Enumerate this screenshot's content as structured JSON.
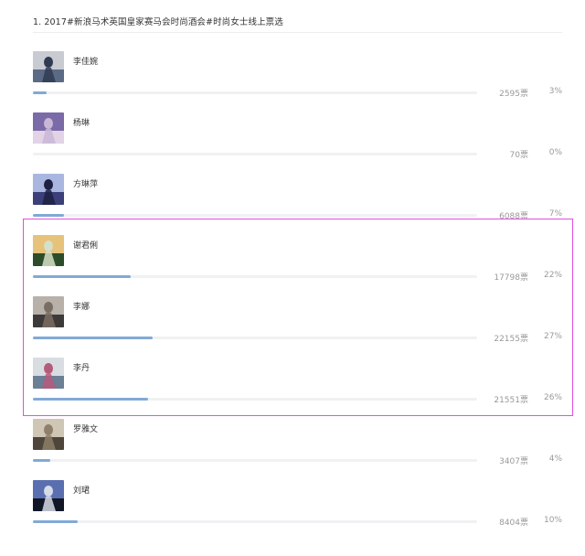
{
  "poll": {
    "title": "1. 2017#新浪马术英国皇家赛马会时尚酒会#时尚女士线上票选",
    "accent_color": "#82a9d6",
    "highlight_color": "#e04fe0",
    "candidates": [
      {
        "name": "李佳婉",
        "votes": "2595票",
        "percent": "3%",
        "share": 0.03,
        "thumbnail": "photo-thumbnail"
      },
      {
        "name": "杨琳",
        "votes": "70票",
        "percent": "0%",
        "share": 0.0,
        "thumbnail": "photo-thumbnail"
      },
      {
        "name": "方琳萍",
        "votes": "6088票",
        "percent": "7%",
        "share": 0.07,
        "thumbnail": "photo-thumbnail"
      },
      {
        "name": "谢君俐",
        "votes": "17798票",
        "percent": "22%",
        "share": 0.22,
        "thumbnail": "photo-thumbnail"
      },
      {
        "name": "李娜",
        "votes": "22155票",
        "percent": "27%",
        "share": 0.27,
        "thumbnail": "photo-thumbnail"
      },
      {
        "name": "李丹",
        "votes": "21551票",
        "percent": "26%",
        "share": 0.26,
        "thumbnail": "photo-thumbnail"
      },
      {
        "name": "罗雅文",
        "votes": "3407票",
        "percent": "4%",
        "share": 0.04,
        "thumbnail": "photo-thumbnail"
      },
      {
        "name": "刘珺",
        "votes": "8404票",
        "percent": "10%",
        "share": 0.1,
        "thumbnail": "photo-thumbnail"
      }
    ]
  }
}
